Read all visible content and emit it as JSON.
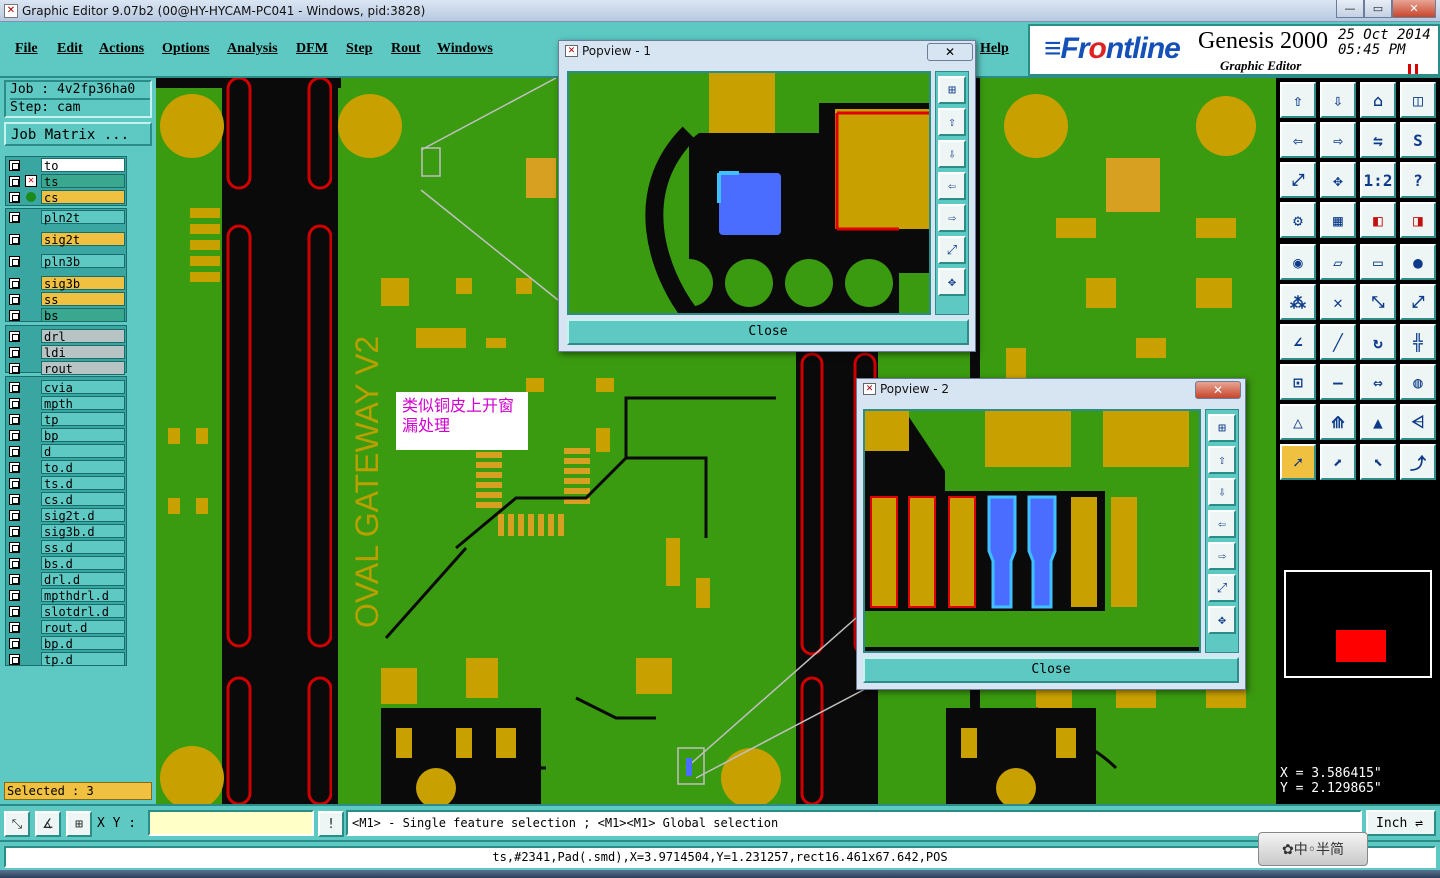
{
  "window": {
    "title": "Graphic Editor 9.07b2 (00@HY-HYCAM-PC041 - Windows, pid:3828)",
    "min_label": "—",
    "max_label": "▭",
    "close_label": "✕"
  },
  "menu": [
    {
      "label": "File"
    },
    {
      "label": "Edit"
    },
    {
      "label": "Actions"
    },
    {
      "label": "Options"
    },
    {
      "label": "Analysis"
    },
    {
      "label": "DFM"
    },
    {
      "label": "Step"
    },
    {
      "label": "Rout"
    },
    {
      "label": "Windows"
    },
    {
      "label": "Help"
    }
  ],
  "branding": {
    "logo_a": "≡Fr",
    "logo_b": "o",
    "logo_c": "ntline",
    "product": "Genesis 2000",
    "subtitle": "Graphic Editor",
    "date": "25 Oct 2014",
    "time": "05:45 PM"
  },
  "job": {
    "job_line": "Job : 4v2fp36ha0",
    "step_line": "Step: cam",
    "matrix_button": "Job Matrix ..."
  },
  "layers": [
    {
      "name": "to",
      "group": 0,
      "color": "#ffffff"
    },
    {
      "name": "ts",
      "group": 0,
      "color": "#3aa88f",
      "marker": true
    },
    {
      "name": "cs",
      "group": 0,
      "color": "#f0c040",
      "dot": true
    },
    {
      "name": "pln2t",
      "group": 1,
      "color": "#5ec9c3"
    },
    {
      "name": "sig2t",
      "group": 1,
      "color": "#f0c040"
    },
    {
      "name": "pln3b",
      "group": 1,
      "color": "#5ec9c3"
    },
    {
      "name": "sig3b",
      "group": 1,
      "color": "#f0c040"
    },
    {
      "name": "ss",
      "group": 1,
      "color": "#f0c040"
    },
    {
      "name": "bs",
      "group": 1,
      "color": "#3aa88f"
    },
    {
      "name": "drl",
      "group": 2,
      "color": "#b8c4c4"
    },
    {
      "name": "ldi",
      "group": 2,
      "color": "#b8c4c4"
    },
    {
      "name": "rout",
      "group": 2,
      "color": "#b8c4c4"
    },
    {
      "name": "cvia",
      "group": 3,
      "color": "#5ec9c3"
    },
    {
      "name": "mpth",
      "group": 3,
      "color": "#5ec9c3"
    },
    {
      "name": "tp",
      "group": 3,
      "color": "#5ec9c3"
    },
    {
      "name": "bp",
      "group": 3,
      "color": "#5ec9c3"
    },
    {
      "name": "d",
      "group": 3,
      "color": "#5ec9c3"
    },
    {
      "name": "to.d",
      "group": 3,
      "color": "#5ec9c3"
    },
    {
      "name": "ts.d",
      "group": 3,
      "color": "#5ec9c3"
    },
    {
      "name": "cs.d",
      "group": 3,
      "color": "#5ec9c3"
    },
    {
      "name": "sig2t.d",
      "group": 3,
      "color": "#5ec9c3"
    },
    {
      "name": "sig3b.d",
      "group": 3,
      "color": "#5ec9c3"
    },
    {
      "name": "ss.d",
      "group": 3,
      "color": "#5ec9c3"
    },
    {
      "name": "bs.d",
      "group": 3,
      "color": "#5ec9c3"
    },
    {
      "name": "drl.d",
      "group": 3,
      "color": "#5ec9c3"
    },
    {
      "name": "mpthdrl.d",
      "group": 3,
      "color": "#5ec9c3"
    },
    {
      "name": "slotdrl.d",
      "group": 3,
      "color": "#5ec9c3"
    },
    {
      "name": "rout.d",
      "group": 3,
      "color": "#5ec9c3"
    },
    {
      "name": "bp.d",
      "group": 3,
      "color": "#5ec9c3"
    },
    {
      "name": "tp.d",
      "group": 3,
      "color": "#5ec9c3"
    }
  ],
  "selected_text": "Selected : 3",
  "board": {
    "silkscreen_text": "OVAL GATEWAY V2",
    "annotation": "类似铜皮上开窗漏处理"
  },
  "popview1": {
    "title": "Popview - 1",
    "close_label": "Close"
  },
  "popview2": {
    "title": "Popview - 2",
    "close_label": "Close"
  },
  "tools": [
    {
      "icon": "zoom-home-icon",
      "glyph": "⇧"
    },
    {
      "icon": "zoom-down-icon",
      "glyph": "⇩"
    },
    {
      "icon": "home-icon",
      "glyph": "⌂"
    },
    {
      "icon": "split-view-icon",
      "glyph": "◫"
    },
    {
      "icon": "pan-left-icon",
      "glyph": "⇦"
    },
    {
      "icon": "pan-right-icon",
      "glyph": "⇨"
    },
    {
      "icon": "mirror-icon",
      "glyph": "⇋"
    },
    {
      "icon": "s-curve-icon",
      "glyph": "S"
    },
    {
      "icon": "fit-icon",
      "glyph": "⤢"
    },
    {
      "icon": "center-icon",
      "glyph": "✥"
    },
    {
      "icon": "scale-icon",
      "glyph": "1:2"
    },
    {
      "icon": "help-icon",
      "glyph": "?"
    },
    {
      "icon": "settings-icon",
      "glyph": "⚙"
    },
    {
      "icon": "grid-icon",
      "glyph": "▦"
    },
    {
      "icon": "layers-icon",
      "glyph": "◧"
    },
    {
      "icon": "layers-red-icon",
      "glyph": "◨"
    },
    {
      "icon": "select-point-icon",
      "glyph": "◉"
    },
    {
      "icon": "select-area-icon",
      "glyph": "▱"
    },
    {
      "icon": "ruler-icon",
      "glyph": "▭"
    },
    {
      "icon": "dot-icon",
      "glyph": "●"
    },
    {
      "icon": "net-icon",
      "glyph": "⁂"
    },
    {
      "icon": "cross-icon",
      "glyph": "✕"
    },
    {
      "icon": "link-icon",
      "glyph": "⤡"
    },
    {
      "icon": "connect-icon",
      "glyph": "⤢"
    },
    {
      "icon": "angle-icon",
      "glyph": "∠"
    },
    {
      "icon": "line-icon",
      "glyph": "╱"
    },
    {
      "icon": "rotate-icon",
      "glyph": "↻"
    },
    {
      "icon": "grid-snap-icon",
      "glyph": "╬"
    },
    {
      "icon": "node-icon",
      "glyph": "⊡"
    },
    {
      "icon": "minus-icon",
      "glyph": "—"
    },
    {
      "icon": "resize-icon",
      "glyph": "⇔"
    },
    {
      "icon": "shape-icon",
      "glyph": "◍"
    },
    {
      "icon": "triangle-icon",
      "glyph": "△"
    },
    {
      "icon": "triangle-up-icon",
      "glyph": "⟰"
    },
    {
      "icon": "triangle-line-icon",
      "glyph": "▲"
    },
    {
      "icon": "triangle-base-icon",
      "glyph": "⩤"
    },
    {
      "icon": "pointer-icon",
      "glyph": "➚"
    },
    {
      "icon": "pointer-box-icon",
      "glyph": "⬈"
    },
    {
      "icon": "pointer-lasso-icon",
      "glyph": "⬉"
    },
    {
      "icon": "pointer-path-icon",
      "glyph": "⤴"
    }
  ],
  "coords": {
    "x": "X = 3.586415\"",
    "y": "Y = 2.129865\""
  },
  "bottom": {
    "xy_label": "X Y :",
    "xy_value": "",
    "message": "<M1> - Single feature selection ; <M1><M1> Global selection",
    "unit": "Inch"
  },
  "status": "ts,#2341,Pad(.smd),X=3.9714504,Y=1.231257,rect16.461x67.642,POS",
  "ime": "✿中◦半简",
  "colors": {
    "panel": "#5ec9c3",
    "board": "#3a9a10",
    "copper": "#c8a000",
    "selected": "#4a6cff",
    "outline": "#e00000"
  }
}
